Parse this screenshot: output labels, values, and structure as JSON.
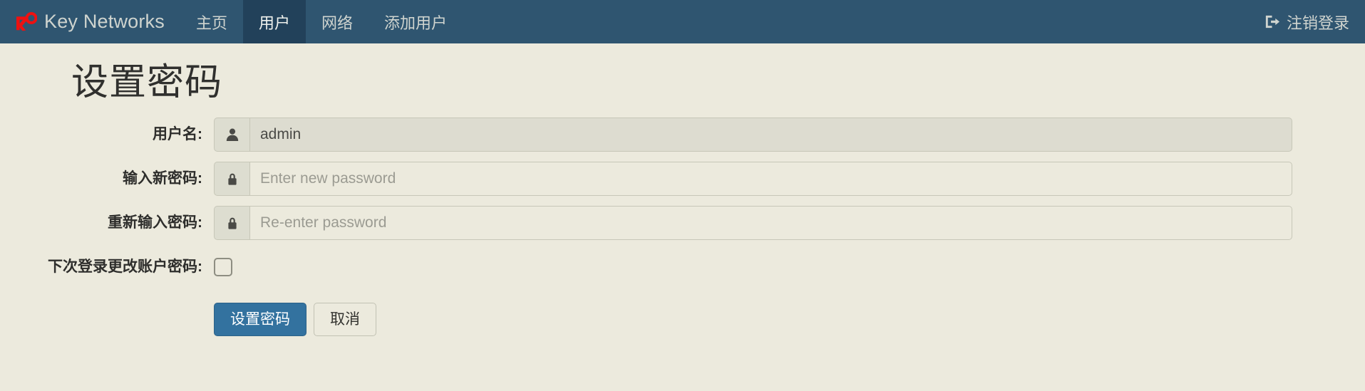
{
  "navbar": {
    "brand": {
      "label": "Key Networks",
      "logo_icon": "key-logo-icon"
    },
    "items": [
      {
        "label": "主页",
        "name": "home",
        "active": false
      },
      {
        "label": "用户",
        "name": "users",
        "active": true
      },
      {
        "label": "网络",
        "name": "network",
        "active": false
      },
      {
        "label": "添加用户",
        "name": "add-user",
        "active": false
      }
    ],
    "logout": {
      "label": "注销登录",
      "icon": "sign-out-icon"
    },
    "colors": {
      "background": "#2f5570",
      "active_background": "#22415a",
      "text": "#cfd4cf",
      "logo": "#ee1111"
    }
  },
  "page": {
    "title": "设置密码",
    "background": "#eceadd"
  },
  "form": {
    "username": {
      "label": "用户名:",
      "icon": "user-icon",
      "value": "admin",
      "placeholder": ""
    },
    "new_password": {
      "label": "输入新密码:",
      "icon": "lock-icon",
      "value": "",
      "placeholder": "Enter new password"
    },
    "confirm_password": {
      "label": "重新输入密码:",
      "icon": "lock-icon",
      "value": "",
      "placeholder": "Re-enter password"
    },
    "change_at_next_login": {
      "label": "下次登录更改账户密码:",
      "checked": false
    },
    "buttons": {
      "submit": "设置密码",
      "cancel": "取消",
      "submit_color": "#33729f"
    }
  }
}
